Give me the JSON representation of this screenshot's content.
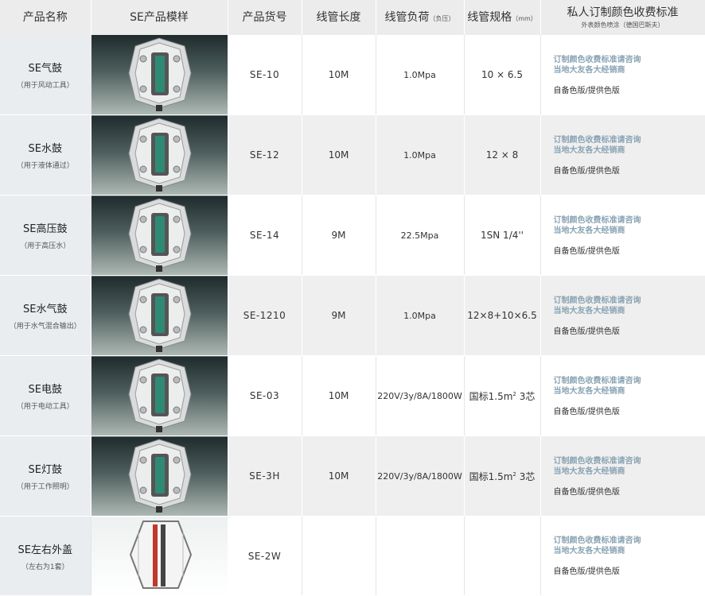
{
  "header": {
    "name": "产品名称",
    "sample": "SE产品模样",
    "code": "产品货号",
    "length": "线管长度",
    "load": "线管负荷",
    "load_unit": "（负压）",
    "spec": "线管规格",
    "spec_unit": "（mm）",
    "custom": "私人订制颜色收费标准",
    "custom_sub": "外表颜色喷涂（德国巴斯夫）"
  },
  "rows": [
    {
      "name": "SE气鼓",
      "note": "（用于风动工具）",
      "code": "SE-10",
      "length": "10M",
      "load": "1.0Mpa",
      "spec": "10 × 6.5",
      "price1": "订制颜色收费标准请咨询",
      "price2": "当地大友各大经销商",
      "price3": "自备色版/提供色版"
    },
    {
      "name": "SE水鼓",
      "note": "（用于液体通过）",
      "code": "SE-12",
      "length": "10M",
      "load": "1.0Mpa",
      "spec": "12 × 8",
      "price1": "订制颜色收费标准请咨询",
      "price2": "当地大友各大经销商",
      "price3": "自备色版/提供色版"
    },
    {
      "name": "SE高压鼓",
      "note": "（用于高压水）",
      "code": "SE-14",
      "length": "9M",
      "load": "22.5Mpa",
      "spec": "1SN 1/4''",
      "price1": "订制颜色收费标准请咨询",
      "price2": "当地大友各大经销商",
      "price3": "自备色版/提供色版"
    },
    {
      "name": "SE水气鼓",
      "note": "（用于水气混合输出）",
      "code": "SE-1210",
      "length": "9M",
      "load": "1.0Mpa",
      "spec": "12×8+10×6.5",
      "price1": "订制颜色收费标准请咨询",
      "price2": "当地大友各大经销商",
      "price3": "自备色版/提供色版"
    },
    {
      "name": "SE电鼓",
      "note": "（用于电动工具）",
      "code": "SE-03",
      "length": "10M",
      "load": "220V/3y/8A/1800W",
      "spec": "国标1.5m",
      "spec_sup": "2",
      "spec_tail": " 3芯",
      "price1": "订制颜色收费标准请咨询",
      "price2": "当地大友各大经销商",
      "price3": "自备色版/提供色版"
    },
    {
      "name": "SE灯鼓",
      "note": "（用于工作照明）",
      "code": "SE-3H",
      "length": "10M",
      "load": "220V/3y/8A/1800W",
      "spec": "国标1.5m",
      "spec_sup": "2",
      "spec_tail": " 3芯",
      "price1": "订制颜色收费标准请咨询",
      "price2": "当地大友各大经销商",
      "price3": "自备色版/提供色版"
    },
    {
      "name": "SE左右外盖",
      "note": "（左右为1套）",
      "code": "SE-2W",
      "length": "",
      "load": "",
      "spec": "",
      "price1": "订制颜色收费标准请咨询",
      "price2": "当地大友各大经销商",
      "price3": "自备色版/提供色版"
    }
  ]
}
